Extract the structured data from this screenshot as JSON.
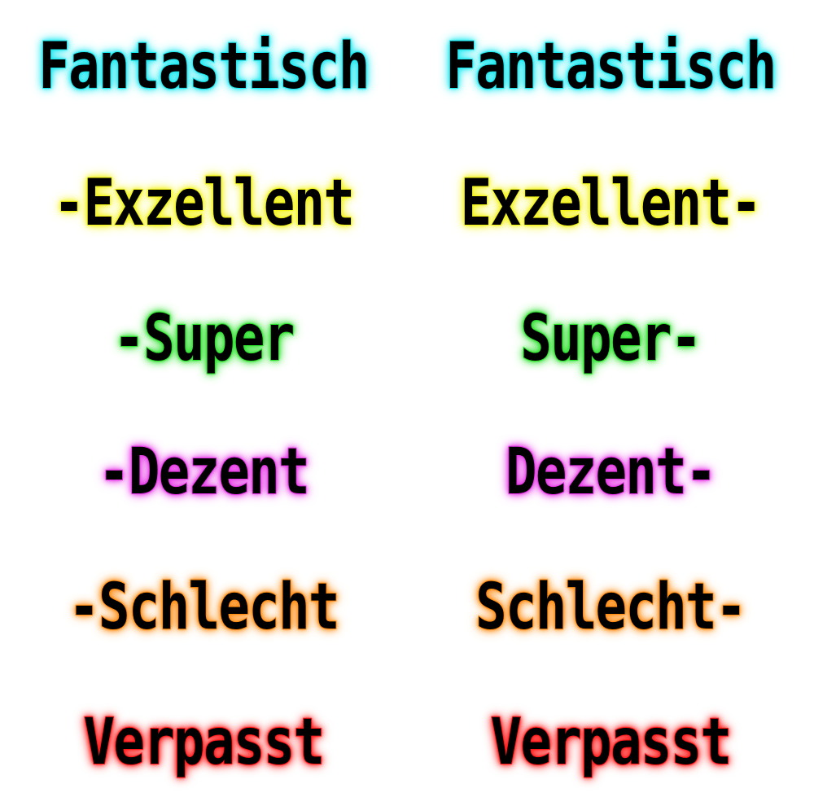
{
  "colors": {
    "fantastic": "#1ee8f0",
    "excellent": "#f2f21a",
    "super": "#2fe02f",
    "decent": "#e63ae6",
    "bad": "#ff8c14",
    "missed": "#ff1a1a"
  },
  "judgments": {
    "left": [
      {
        "text": "Fantastisch"
      },
      {
        "text": "-Exzellent"
      },
      {
        "text": "-Super"
      },
      {
        "text": "-Dezent"
      },
      {
        "text": "-Schlecht"
      },
      {
        "text": "Verpasst"
      }
    ],
    "right": [
      {
        "text": "Fantastisch"
      },
      {
        "text": "Exzellent-"
      },
      {
        "text": "Super-"
      },
      {
        "text": "Dezent-"
      },
      {
        "text": "Schlecht-"
      },
      {
        "text": "Verpasst"
      }
    ]
  }
}
